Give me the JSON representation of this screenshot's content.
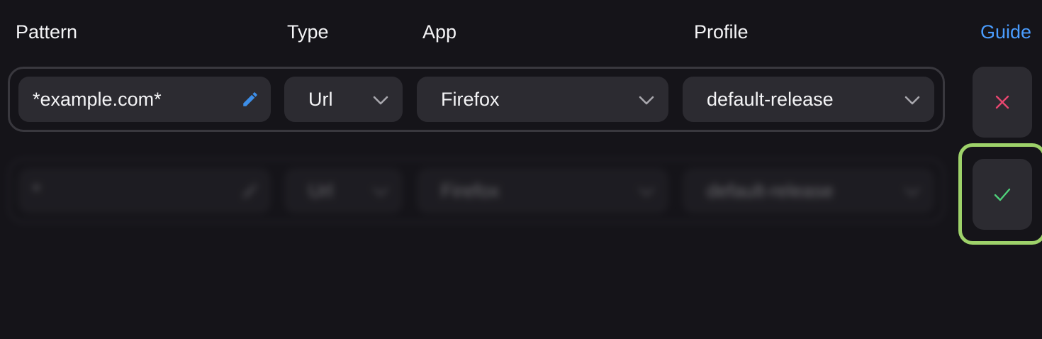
{
  "columns": {
    "pattern": "Pattern",
    "type": "Type",
    "app": "App",
    "profile": "Profile"
  },
  "guide_link": "Guide",
  "rules": [
    {
      "pattern": "*example.com*",
      "type": "Url",
      "app": "Firefox",
      "profile": "default-release"
    },
    {
      "pattern": "*",
      "type": "Url",
      "app": "Firefox",
      "profile": "default-release"
    }
  ],
  "icons": {
    "edit": "pencil-icon",
    "dropdown": "chevron-down-icon",
    "remove": "close-icon",
    "confirm": "check-icon"
  },
  "colors": {
    "background": "#151419",
    "field": "#2c2b31",
    "accent_link": "#4a9dff",
    "pencil": "#3d8ee8",
    "remove": "#e8466f",
    "confirm": "#4fd17a",
    "focus_ring": "#9ed26a"
  }
}
